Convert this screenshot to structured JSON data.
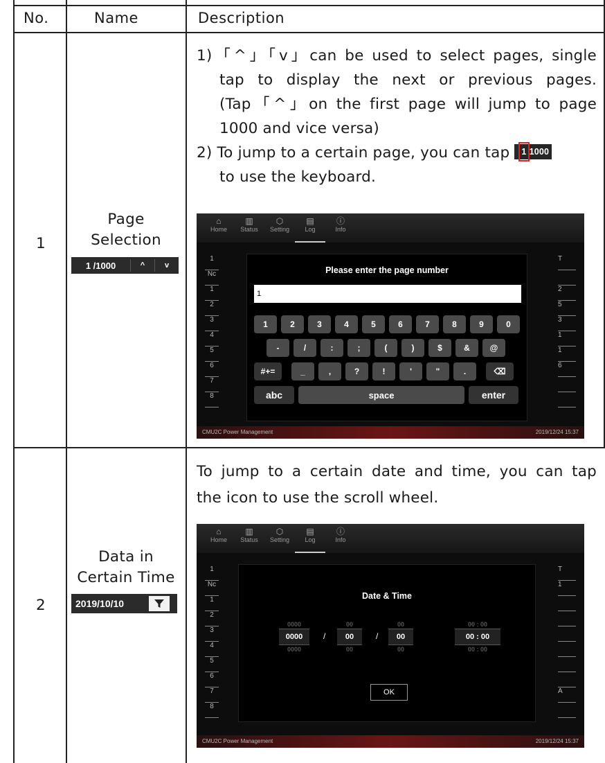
{
  "table": {
    "headers": {
      "no": "No.",
      "name": "Name",
      "description": "Description"
    }
  },
  "rows": [
    {
      "no": "1",
      "name_lines": [
        "Page",
        "Selection"
      ],
      "control": {
        "page": "1 /1000",
        "up": "^",
        "down": "v"
      },
      "desc": {
        "p1": [
          "1)「^」「v」can be used to select pages, single",
          "tap to display the next or previous pages.",
          "(Tap「^」on the first page will jump to page",
          "1000 and vice versa)"
        ],
        "p2_prefix": "2) To jump to a certain page, you can tap",
        "p2_box_cur": "1",
        "p2_box_total": "1000",
        "p2_suffix": "to use the keyboard."
      },
      "shot": {
        "tabs": [
          "Home",
          "Status",
          "Setting",
          "Log",
          "Info"
        ],
        "dialog_title": "Please enter the page number",
        "input_value": "1",
        "row1": [
          "1",
          "2",
          "3",
          "4",
          "5",
          "6",
          "7",
          "8",
          "9",
          "0"
        ],
        "row2": [
          "-",
          "/",
          ":",
          ";",
          "(",
          ")",
          "$",
          "&",
          "@"
        ],
        "row3": [
          "#+=",
          "_",
          ",",
          "?",
          "!",
          "'",
          "\"",
          ".",
          "⌫"
        ],
        "row4": [
          "abc",
          "space",
          "enter"
        ],
        "left_list": [
          "1",
          "Nc",
          "1",
          "2",
          "3",
          "4",
          "5",
          "6",
          "7",
          "8"
        ],
        "right_list": [
          "T",
          "",
          "2",
          "5",
          "3",
          "1",
          "1",
          "6",
          "",
          ""
        ],
        "footer_left": "CMU2C Power Management",
        "footer_right": "2019/12/24 15:37"
      }
    },
    {
      "no": "2",
      "name_lines": [
        "Data in",
        "Certain Time"
      ],
      "control": {
        "date": "2019/10/10"
      },
      "desc": {
        "p1": [
          "To jump to a certain date and time, you can tap",
          "the icon to use the scroll wheel."
        ]
      },
      "shot": {
        "tabs": [
          "Home",
          "Status",
          "Setting",
          "Log",
          "Info"
        ],
        "dialog_title": "Date & Time",
        "year_ghost": "0000",
        "year": "0000",
        "month_ghost": "00",
        "month": "00",
        "day_ghost": "00",
        "day": "00",
        "time_ghost": "00 : 00",
        "time": "00 : 00",
        "sep": "/",
        "ok": "OK",
        "left_list": [
          "1",
          "Nc",
          "1",
          "2",
          "3",
          "4",
          "5",
          "6",
          "7",
          "8"
        ],
        "right_list": [
          "T",
          "1",
          "",
          "",
          "",
          "",
          "",
          "",
          "A",
          ""
        ],
        "footer_left": "CMU2C Power Management",
        "footer_right": "2019/12/24 15:37"
      }
    }
  ]
}
